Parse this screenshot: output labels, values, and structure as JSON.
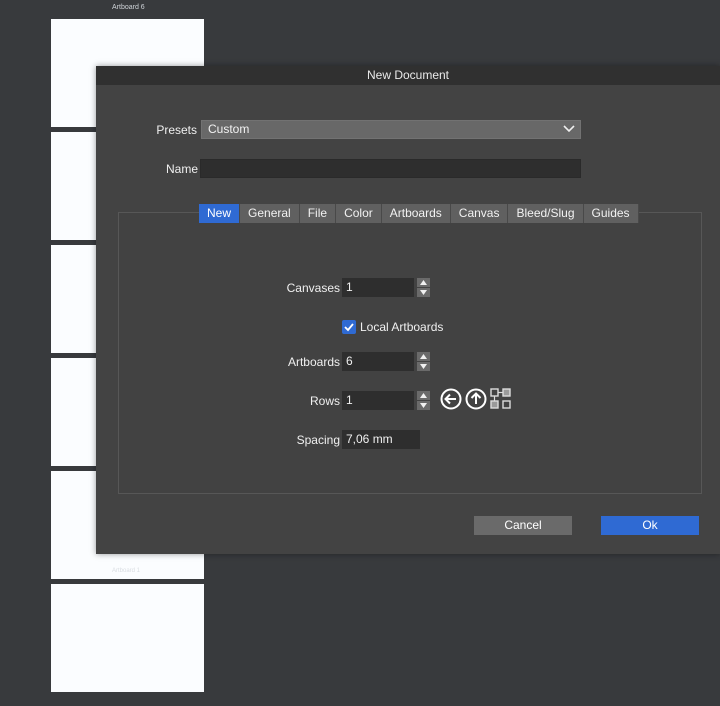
{
  "background": {
    "artboard_label": "Artboard 6",
    "artboard_ghost_label": "Artboard 1",
    "artboard_count": 6
  },
  "dialog": {
    "title": "New Document",
    "presets_label": "Presets",
    "presets_value": "Custom",
    "name_label": "Name",
    "name_value": "",
    "tabs": [
      {
        "label": "New",
        "active": true
      },
      {
        "label": "General",
        "active": false
      },
      {
        "label": "File",
        "active": false
      },
      {
        "label": "Color",
        "active": false
      },
      {
        "label": "Artboards",
        "active": false
      },
      {
        "label": "Canvas",
        "active": false
      },
      {
        "label": "Bleed/Slug",
        "active": false
      },
      {
        "label": "Guides",
        "active": false
      }
    ],
    "canvases_label": "Canvases",
    "canvases_value": "1",
    "local_artboards_label": "Local Artboards",
    "local_artboards_checked": true,
    "artboards_label": "Artboards",
    "artboards_value": "6",
    "rows_label": "Rows",
    "rows_value": "1",
    "spacing_label": "Spacing",
    "spacing_value": "7,06 mm",
    "layout_icons": [
      "arrow-left-circle-icon",
      "arrow-up-circle-icon",
      "grid-layout-icon"
    ],
    "cancel_label": "Cancel",
    "ok_label": "Ok"
  },
  "colors": {
    "accent": "#2f6ad3",
    "dialog_bg": "#434343",
    "workspace_bg": "#383a3d"
  }
}
